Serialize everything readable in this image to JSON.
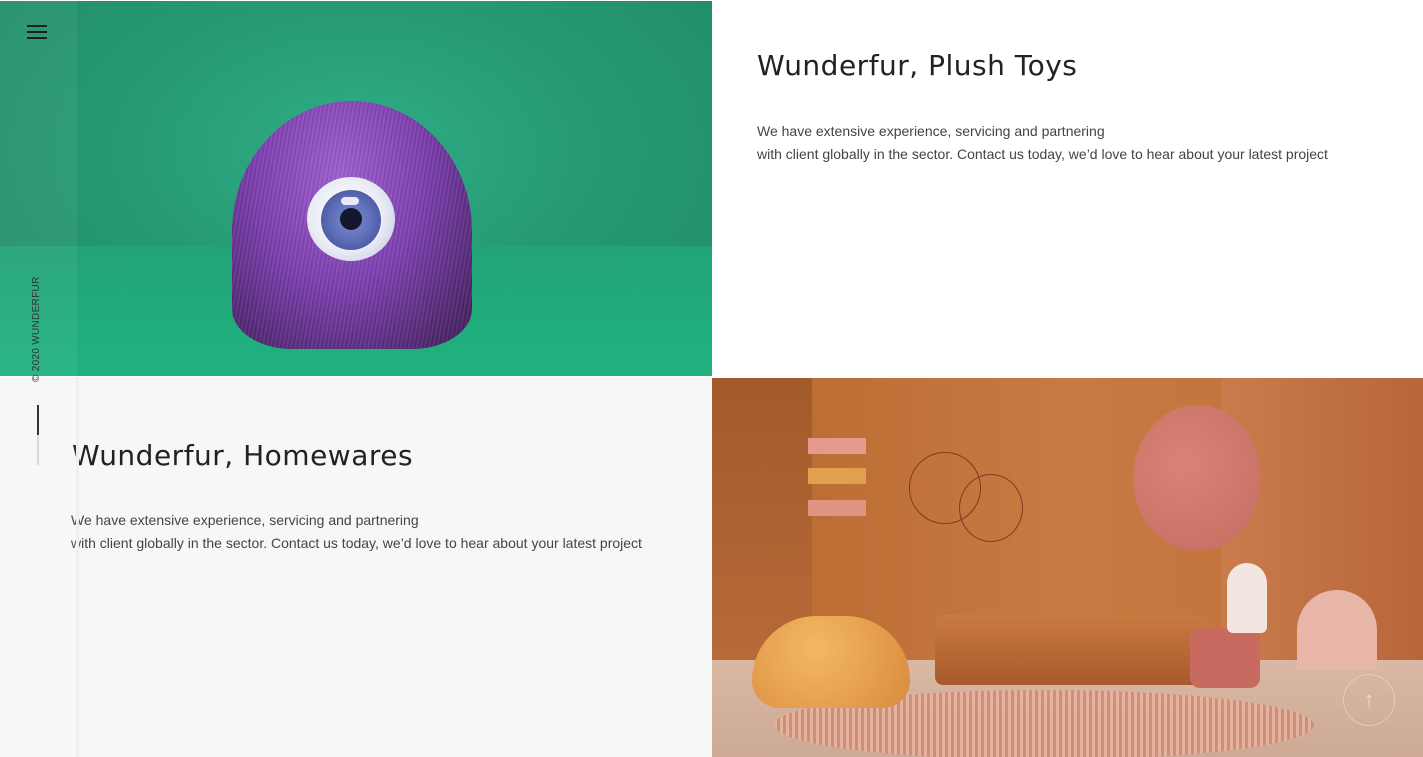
{
  "sections": [
    {
      "title": "Wunderfur, Plush Toys",
      "desc_line1": "We have extensive experience, servicing and partnering",
      "desc_line2": "with client globally in the sector. Contact us today, we’d love to hear about your latest project"
    },
    {
      "title": "Wunderfur, Homewares",
      "desc_line1": "We have extensive experience, servicing and partnering",
      "desc_line2": "with client globally in the sector. Contact us today, we’d love to hear about your latest project"
    }
  ],
  "sidebar": {
    "copyright": "© 2020 WUNDERFUR",
    "menu_icon": "hamburger-menu-icon",
    "progress_fraction": 0.5
  },
  "scroll_top_icon": "arrow-up-icon",
  "scroll_top_glyph": "↑",
  "colors": {
    "green_bg": "#279a74",
    "monster_purple": "#7d3fb0",
    "terracotta": "#c3743f",
    "panel_gray": "#f7f7f7",
    "text_dark": "#222222"
  }
}
